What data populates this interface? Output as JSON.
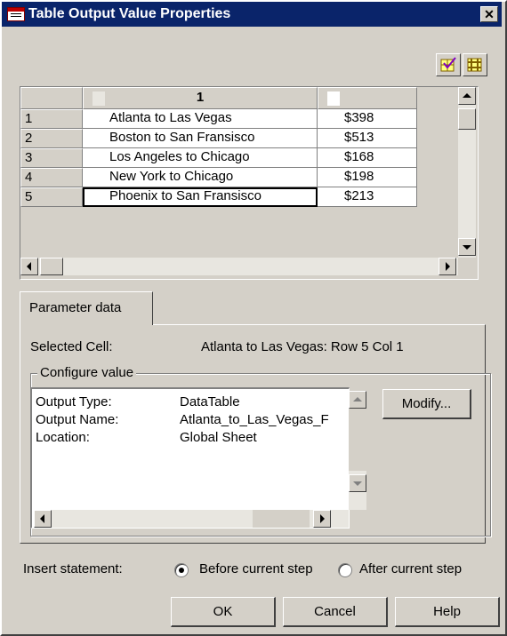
{
  "window": {
    "title": "Table Output Value Properties",
    "close_glyph": "✕"
  },
  "toolbar": {
    "icons": [
      "check-grid-icon",
      "grid-icon"
    ]
  },
  "grid": {
    "column_headers": [
      "",
      "1",
      ""
    ],
    "rows": [
      {
        "num": "1",
        "route": "Atlanta to Las Vegas",
        "price": "$398"
      },
      {
        "num": "2",
        "route": "Boston to San Fransisco",
        "price": "$513"
      },
      {
        "num": "3",
        "route": "Los Angeles to Chicago",
        "price": "$168"
      },
      {
        "num": "4",
        "route": "New York to Chicago",
        "price": "$198"
      },
      {
        "num": "5",
        "route": "Phoenix to San Fransisco",
        "price": "$213"
      }
    ],
    "selected_row": 5
  },
  "tab": {
    "label": "Parameter data"
  },
  "selected_cell": {
    "label": "Selected Cell:",
    "value": "Atlanta to Las Vegas: Row 5 Col 1"
  },
  "configure": {
    "title": "Configure value",
    "fields": [
      {
        "key": "Output Type:",
        "value": "DataTable"
      },
      {
        "key": "Output Name:",
        "value": "Atlanta_to_Las_Vegas_F"
      },
      {
        "key": "Location:",
        "value": "Global Sheet"
      }
    ],
    "modify_label": "Modify..."
  },
  "insert": {
    "label": "Insert statement:",
    "options": [
      {
        "label": "Before current step",
        "selected": true
      },
      {
        "label": "After current step",
        "selected": false
      }
    ]
  },
  "buttons": {
    "ok": "OK",
    "cancel": "Cancel",
    "help": "Help"
  }
}
